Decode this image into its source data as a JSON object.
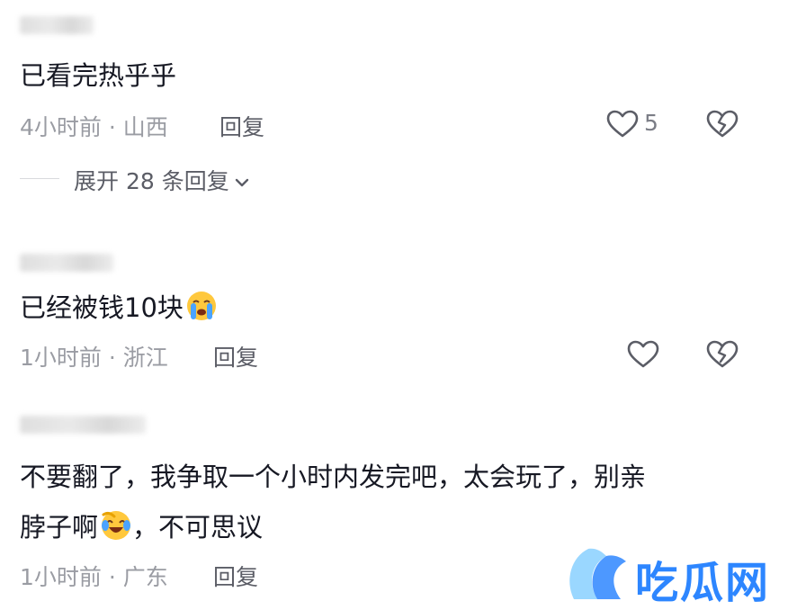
{
  "comments": [
    {
      "content": "已看完热乎乎",
      "time_location": "4小时前 · 山西",
      "reply_label": "回复",
      "like_count": "5",
      "expand_label": "展开 28 条回复"
    },
    {
      "content": "已经被钱10块",
      "emoji": "crying-face-emoji",
      "time_location": "1小时前 · 浙江",
      "reply_label": "回复"
    },
    {
      "content_line1": "不要翻了，我争取一个小时内发完吧，太会玩了，别亲",
      "content_line2_a": "脖子啊",
      "emoji": "laughing-crying-face-emoji",
      "content_line2_b": "，不可思议",
      "time_location": "1小时前 · 广东",
      "reply_label": "回复"
    }
  ],
  "watermark": {
    "text": "吃瓜网",
    "color": "#2d86ff"
  },
  "icons": {
    "like": "heart-outline-icon",
    "dislike": "broken-heart-icon",
    "expand": "chevron-down-icon"
  }
}
